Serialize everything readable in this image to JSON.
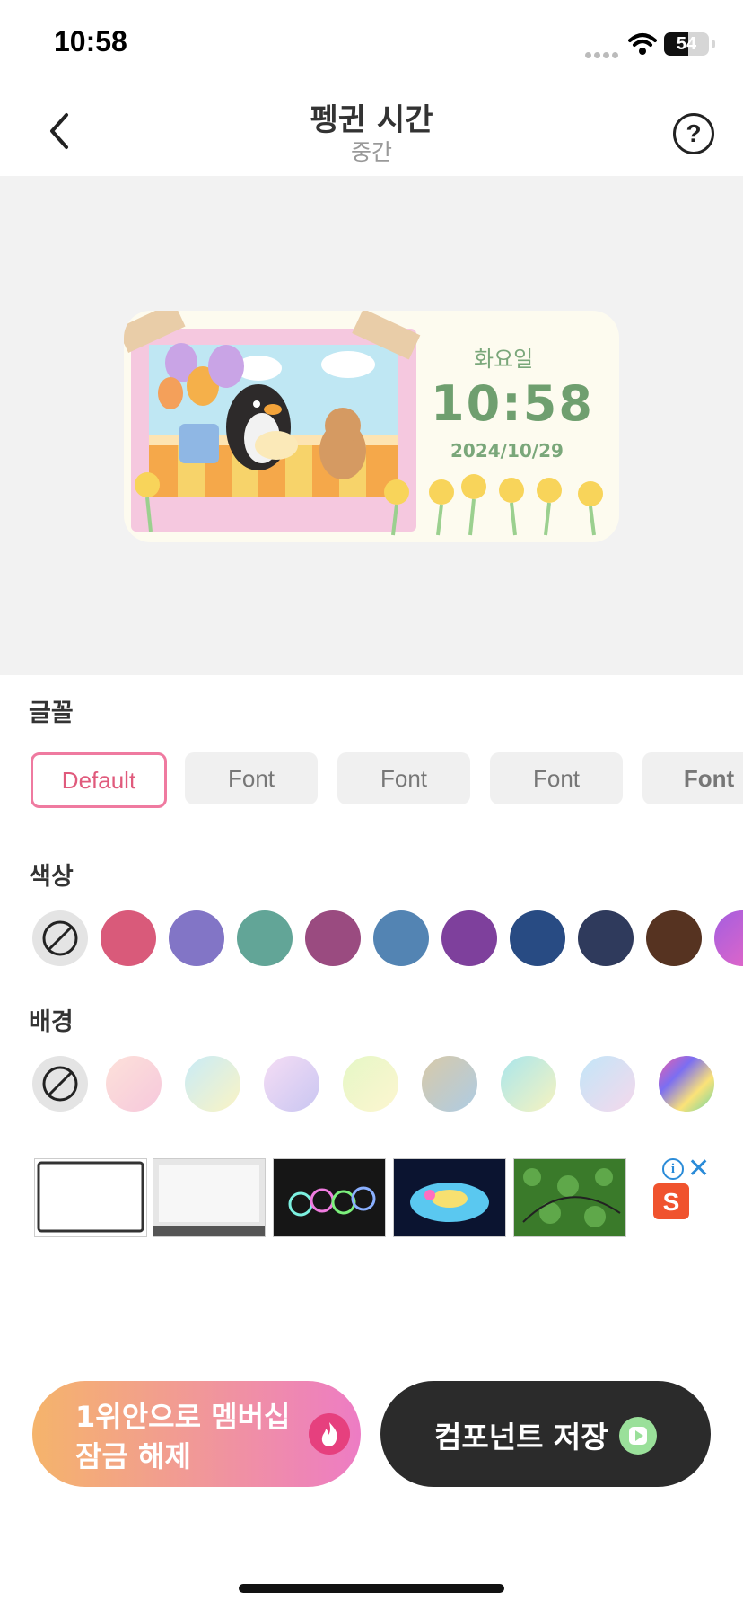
{
  "status": {
    "time": "10:58",
    "battery": "54",
    "battery_level": 0.54
  },
  "nav": {
    "title": "펭귄 시간",
    "subtitle": "중간",
    "help_symbol": "?"
  },
  "widget": {
    "day": "화요일",
    "time": "10:58",
    "date": "2024/10/29"
  },
  "font_section": {
    "label": "글꼴",
    "options": [
      {
        "label": "Default",
        "selected": true
      },
      {
        "label": "Font",
        "selected": false
      },
      {
        "label": "Font",
        "selected": false
      },
      {
        "label": "Font",
        "selected": false
      },
      {
        "label": "Font",
        "selected": false
      }
    ]
  },
  "color_section": {
    "label": "색상",
    "colors": [
      "#d95a7a",
      "#8275c6",
      "#62a597",
      "#9a4b80",
      "#5384b3",
      "#7e409c",
      "#284b83",
      "#2f3a5c",
      "#563321"
    ],
    "partial_gradient": [
      "#a35ee0",
      "#e066c8"
    ]
  },
  "background_section": {
    "label": "배경",
    "gradients": [
      [
        "#fde1d9",
        "#f6c8dc"
      ],
      [
        "#c8ebf7",
        "#fbf4c4"
      ],
      [
        "#f5ddf4",
        "#c9c6f2"
      ],
      [
        "#e5f7c6",
        "#fdf6d0"
      ],
      [
        "#d8c9a8",
        "#aecce4"
      ],
      [
        "#a9e6ec",
        "#f7f3c0"
      ],
      [
        "#c2e6f8",
        "#f5d8ec"
      ],
      [
        "#f05ea7",
        "#7b6ef2",
        "#fbe278",
        "#6ed6a5"
      ]
    ]
  },
  "ad": {
    "brand_letter": "S",
    "info_symbol": "i",
    "close_symbol": "✕"
  },
  "buttons": {
    "member_line1": "1위안으로 멤버십",
    "member_line2": "잠금 해제",
    "save": "컴포넌트 저장"
  }
}
